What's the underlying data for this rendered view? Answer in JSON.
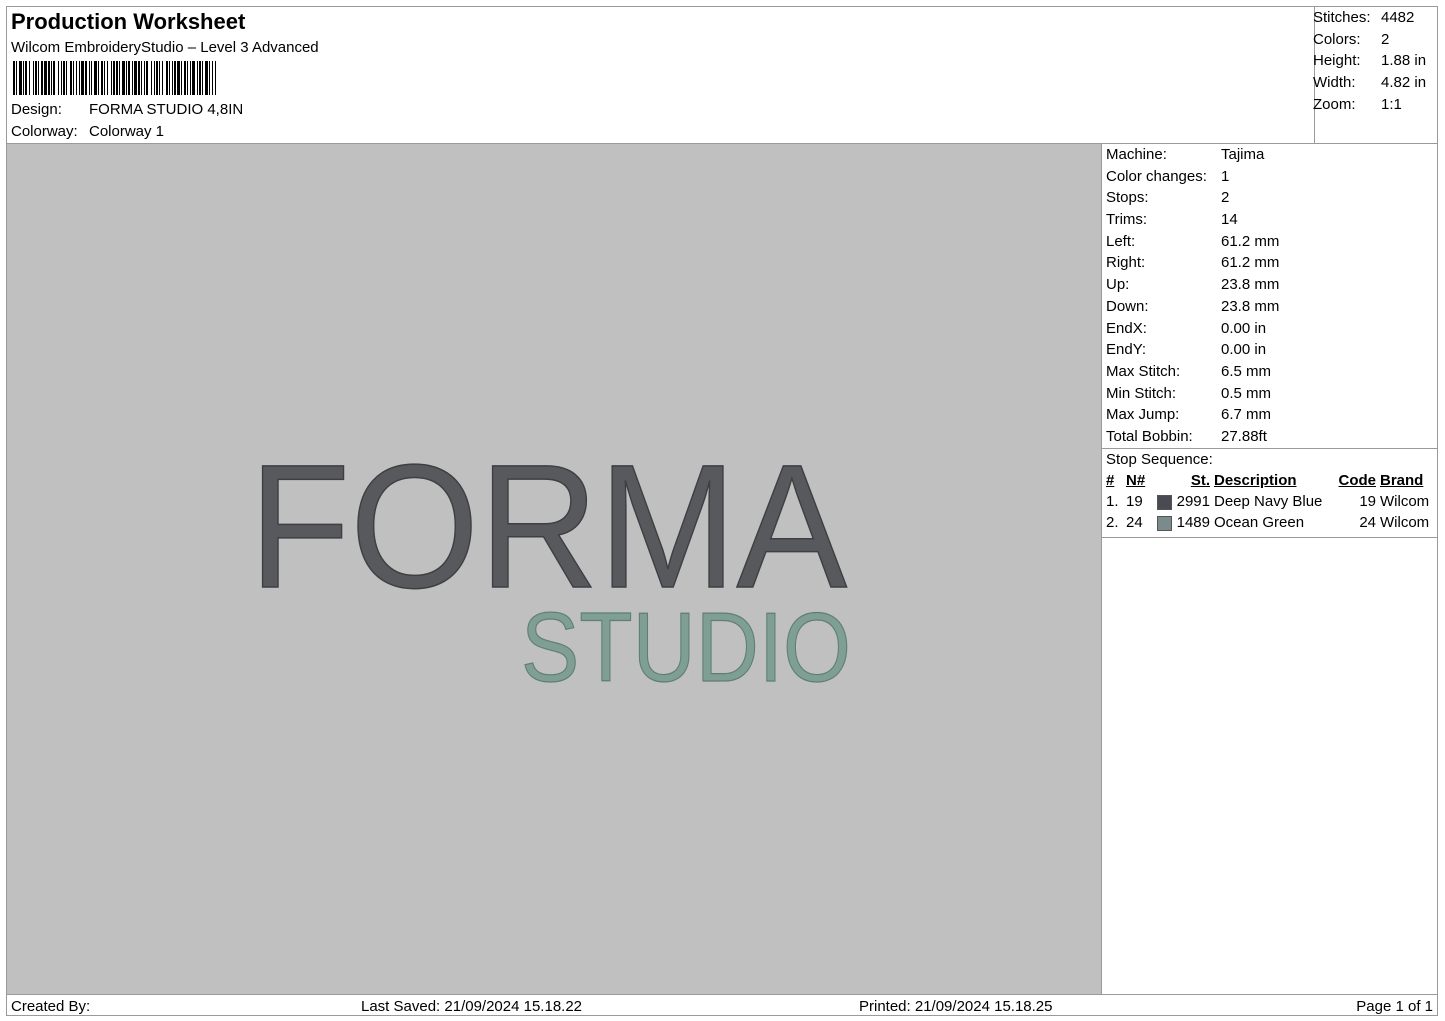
{
  "header": {
    "title": "Production Worksheet",
    "subtitle": "Wilcom EmbroideryStudio – Level 3 Advanced",
    "design_label": "Design:",
    "design_value": "FORMA STUDIO 4,8IN",
    "colorway_label": "Colorway:",
    "colorway_value": "Colorway 1"
  },
  "stats": [
    {
      "label": "Stitches:",
      "value": "4482"
    },
    {
      "label": "Colors:",
      "value": "2"
    },
    {
      "label": "Height:",
      "value": "1.88 in"
    },
    {
      "label": "Width:",
      "value": "4.82 in"
    },
    {
      "label": "Zoom:",
      "value": "1:1"
    }
  ],
  "machine_info": [
    {
      "label": "Machine:",
      "value": "Tajima"
    },
    {
      "label": "Color changes:",
      "value": "1"
    },
    {
      "label": "Stops:",
      "value": "2"
    },
    {
      "label": "Trims:",
      "value": "14"
    },
    {
      "label": "Left:",
      "value": "61.2 mm"
    },
    {
      "label": "Right:",
      "value": "61.2 mm"
    },
    {
      "label": "Up:",
      "value": "23.8 mm"
    },
    {
      "label": "Down:",
      "value": "23.8 mm"
    },
    {
      "label": "EndX:",
      "value": "0.00 in"
    },
    {
      "label": "EndY:",
      "value": "0.00 in"
    },
    {
      "label": "Max Stitch:",
      "value": "6.5 mm"
    },
    {
      "label": "Min Stitch:",
      "value": "0.5 mm"
    },
    {
      "label": "Max Jump:",
      "value": "6.7 mm"
    },
    {
      "label": "Total Bobbin:",
      "value": "27.88ft"
    }
  ],
  "stop_sequence": {
    "title": "Stop Sequence:",
    "columns": [
      "#",
      "N#",
      "St.",
      "Description",
      "Code",
      "Brand"
    ],
    "rows": [
      {
        "index": "1.",
        "n": "19",
        "color": "#4a4a52",
        "st": "2991",
        "description": "Deep Navy Blue",
        "code": "19",
        "brand": "Wilcom"
      },
      {
        "index": "2.",
        "n": "24",
        "color": "#7b8a8c",
        "st": "1489",
        "description": "Ocean Green",
        "code": "24",
        "brand": "Wilcom"
      }
    ]
  },
  "design_preview": {
    "line1": "FORMA",
    "line2": "STUDIO",
    "line1_color": "#58595d",
    "line2_color": "#7f9f94",
    "background": "#c0c0c0"
  },
  "footer": {
    "created_by": "Created By:",
    "last_saved": "Last Saved: 21/09/2024 15.18.22",
    "printed": "Printed: 21/09/2024 15.18.25",
    "page": "Page 1 of 1"
  }
}
